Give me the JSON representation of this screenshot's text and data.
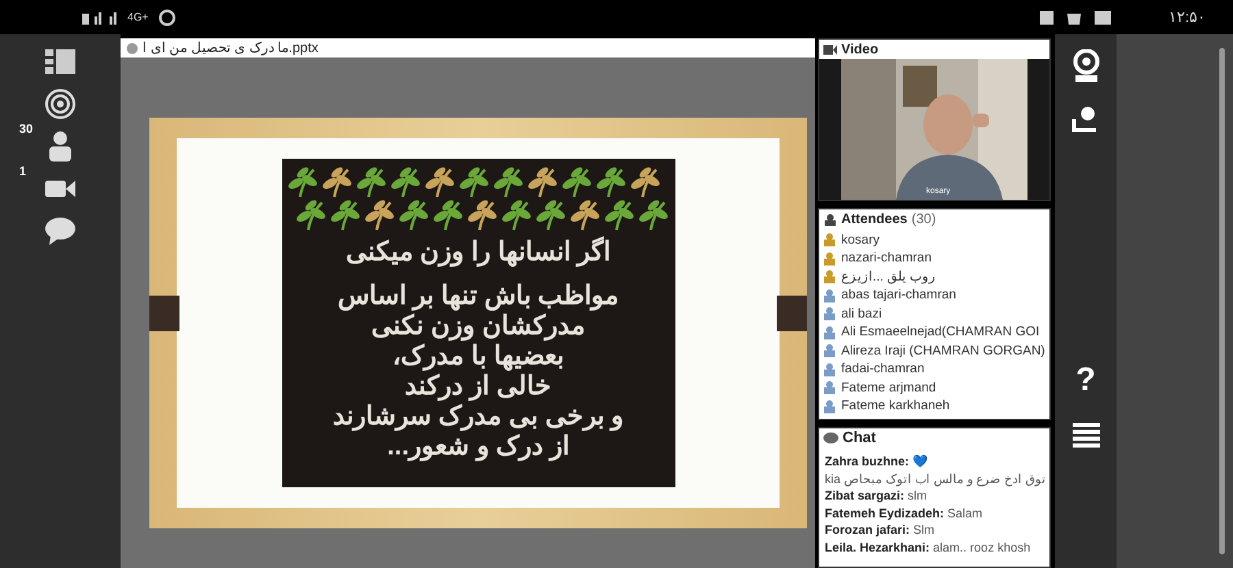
{
  "status_bar": {
    "time": "۱۲:۵۰",
    "network": "4G+"
  },
  "sidebar": {
    "items": [
      {
        "kind": "layout"
      },
      {
        "kind": "broadcast"
      },
      {
        "kind": "attendees",
        "count": "30"
      },
      {
        "kind": "camera",
        "count": "1"
      },
      {
        "kind": "chat"
      }
    ]
  },
  "presentation": {
    "file_name": "ما درک ی تحصیل من ای ا.pptx",
    "slide": {
      "heading": "اگر انسانها را وزن میکنی",
      "lines": [
        "مواظب باش تنها بر اساس",
        "مدرکشان وزن نکنی",
        "بعضیها با مدرک،",
        "خالی از درکند",
        "و برخی بی مدرک سرشارند",
        "از درک و شعور..."
      ]
    }
  },
  "video": {
    "title": "Video",
    "caption": "kosary"
  },
  "attendees": {
    "title": "Attendees",
    "count": "(30)",
    "items": [
      {
        "name": "kosary",
        "host": true
      },
      {
        "name": "nazari-chamran",
        "host": true
      },
      {
        "name": "روب یلق ...ازیزع",
        "host": true
      },
      {
        "name": "abas tajari-chamran",
        "host": false
      },
      {
        "name": "ali bazi",
        "host": false
      },
      {
        "name": "Ali Esmaeelnejad(CHAMRAN  GOI",
        "host": false
      },
      {
        "name": "Alireza Iraji (CHAMRAN GORGAN)",
        "host": false
      },
      {
        "name": "fadai-chamran",
        "host": false
      },
      {
        "name": "Fateme arjmand",
        "host": false
      },
      {
        "name": "Fateme karkhaneh",
        "host": false
      }
    ]
  },
  "chat": {
    "title": "Chat",
    "messages": [
      {
        "sender": "Zahra buzhne:",
        "text": "💙"
      },
      {
        "text": "kia توق ادخ ضرع و مالس اب اتوک مبحاص"
      },
      {
        "sender": "Zibat sargazi:",
        "text": "slm"
      },
      {
        "sender": "Fatemeh Eydizadeh:",
        "text": "Salam"
      },
      {
        "sender": "Forozan jafari:",
        "text": "Slm"
      },
      {
        "sender": "Leila. Hezarkhani:",
        "text": "alam.. rooz khosh"
      }
    ]
  },
  "right_toolbar": {
    "items": [
      {
        "kind": "webcam"
      },
      {
        "kind": "user"
      },
      {
        "kind": "help",
        "label": "?"
      },
      {
        "kind": "menu"
      }
    ]
  }
}
